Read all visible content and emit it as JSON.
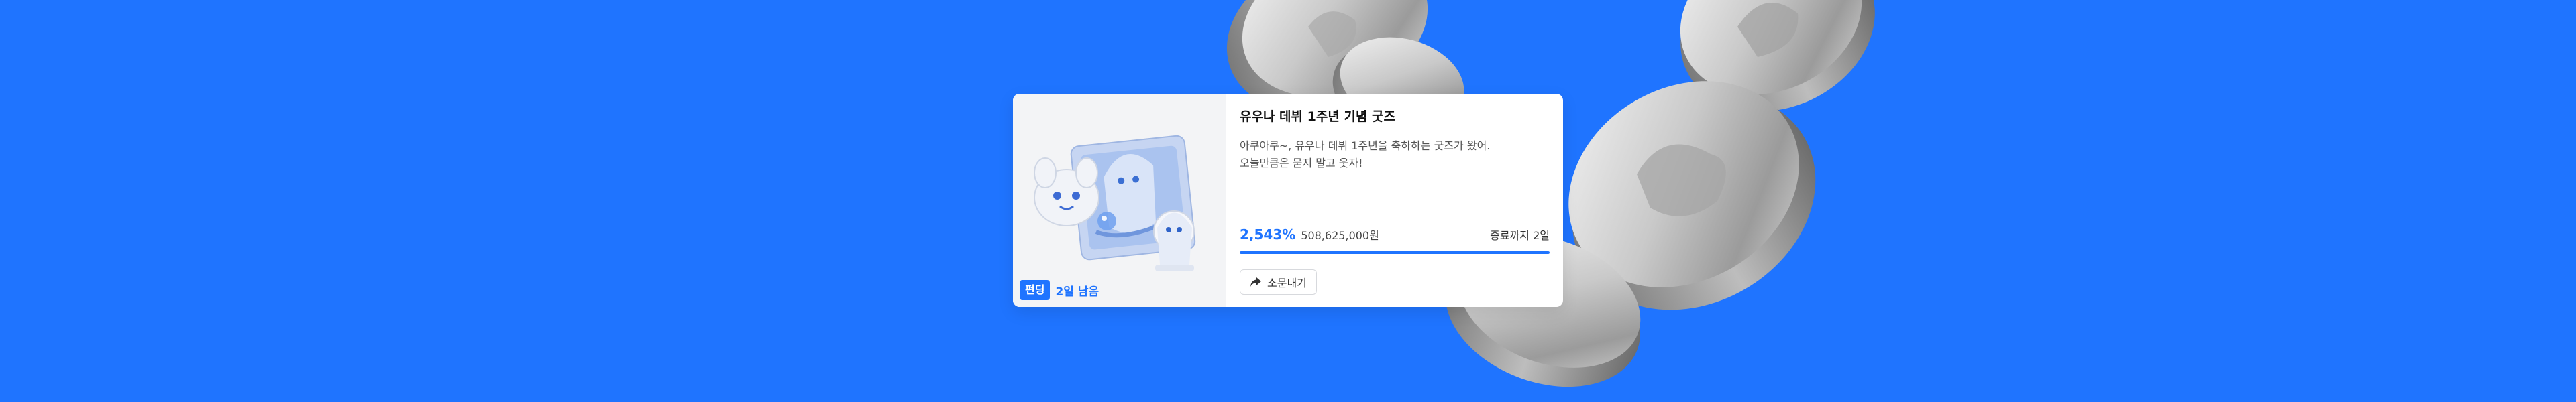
{
  "card": {
    "title": "유우나 데뷔 1주년 기념 굿즈",
    "description_line1": "아쿠아쿠~, 유우나 데뷔 1주년을 축하하는 굿즈가 왔어.",
    "description_line2": "오늘만큼은 묻지 말고 웃자!",
    "funding_badge": "펀딩",
    "days_left": "2일 남음",
    "achievement_rate": "2,543%",
    "amount_raised": "508,625,000원",
    "ends_in": "종료까지 2일",
    "progress_fraction": 1.0,
    "share_label": "소문내기",
    "share_icon": "share-arrow-icon"
  },
  "colors": {
    "background": "#1f74ff",
    "accent": "#1f74ff",
    "card": "#ffffff",
    "coin": "#c8c8c8"
  }
}
